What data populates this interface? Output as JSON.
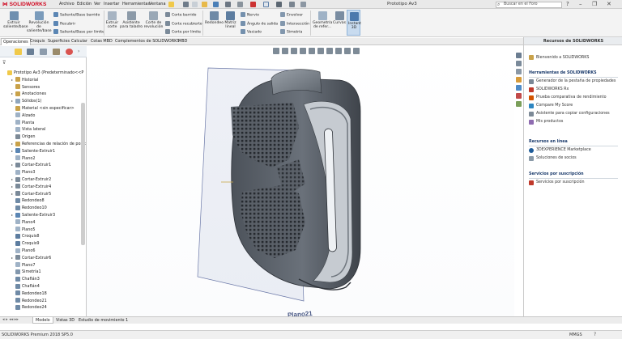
{
  "app": {
    "logo_text": "SOLIDWORKS",
    "doc_title": "Prototipo Av3"
  },
  "menu": [
    "Archivo",
    "Edición",
    "Ver",
    "Insertar",
    "Herramientas",
    "Ventana"
  ],
  "search": {
    "placeholder": "Buscar en el Foro"
  },
  "ribbon": {
    "extrude_boss": "Extruir\nsaliente/base",
    "revolve_boss": "Revolución\nde\nsaliente/base",
    "swept_boss": "Saliente/Base barrido",
    "lofted_boss": "Recubrir",
    "boundary_boss": "Saliente/Base por límite",
    "extrude_cut": "Extruir\ncorte",
    "hole_wizard": "Asistente\npara taladro",
    "revolve_cut": "Corte de\nrevolución",
    "swept_cut": "Corte barrido",
    "lofted_cut": "Corte recubierto",
    "boundary_cut": "Corte por límite",
    "fillet": "Redondeo",
    "linear_pattern": "Matriz\nlineal",
    "rib": "Nervio",
    "draft": "Ángulo de salida",
    "shell": "Vaciado",
    "wrap": "Envolver",
    "intersect": "Intersección",
    "mirror": "Simetría",
    "ref_geometry": "Geometría\nde refer...",
    "curves": "Curvas",
    "instant3d": "Instant\n3D"
  },
  "command_tabs": [
    "Operaciones",
    "Croquis",
    "Superficies",
    "Calcular",
    "Cotas MBD",
    "Complementos de SOLIDWORKS",
    "MBD"
  ],
  "feature_tree": [
    {
      "label": "Prototipo Av3  (Predeterminado<<P",
      "icon": "part",
      "level": 0
    },
    {
      "label": "Historial",
      "icon": "folder",
      "level": 1,
      "expand": true
    },
    {
      "label": "Sensores",
      "icon": "folder",
      "level": 1
    },
    {
      "label": "Anotaciones",
      "icon": "folder",
      "level": 1,
      "expand": true
    },
    {
      "label": "Sólidos(1)",
      "icon": "solid",
      "level": 1,
      "expand": true
    },
    {
      "label": "Material <sin especificar>",
      "icon": "material",
      "level": 1
    },
    {
      "label": "Alzado",
      "icon": "plane",
      "level": 1
    },
    {
      "label": "Planta",
      "icon": "plane",
      "level": 1
    },
    {
      "label": "Vista lateral",
      "icon": "plane",
      "level": 1
    },
    {
      "label": "Origen",
      "icon": "origin",
      "level": 1
    },
    {
      "label": "Referencias de relación de posic",
      "icon": "folder",
      "level": 1,
      "expand": true
    },
    {
      "label": "Saliente-Extruir1",
      "icon": "feature",
      "level": 1,
      "expand": true
    },
    {
      "label": "Plano2",
      "icon": "plane",
      "level": 1
    },
    {
      "label": "Cortar-Extruir1",
      "icon": "cut",
      "level": 1,
      "expand": true
    },
    {
      "label": "Plano3",
      "icon": "plane",
      "level": 1
    },
    {
      "label": "Cortar-Extruir2",
      "icon": "cut",
      "level": 1,
      "expand": true
    },
    {
      "label": "Cortar-Extruir4",
      "icon": "cut",
      "level": 1,
      "expand": true
    },
    {
      "label": "Cortar-Extruir5",
      "icon": "cut",
      "level": 1,
      "expand": true
    },
    {
      "label": "Redondeo8",
      "icon": "fillet",
      "level": 1
    },
    {
      "label": "Redondeo10",
      "icon": "fillet",
      "level": 1
    },
    {
      "label": "Saliente-Extruir3",
      "icon": "feature",
      "level": 1,
      "expand": true
    },
    {
      "label": "Plano4",
      "icon": "plane",
      "level": 1
    },
    {
      "label": "Plano5",
      "icon": "plane",
      "level": 1
    },
    {
      "label": "Croquis8",
      "icon": "sketch",
      "level": 1
    },
    {
      "label": "Croquis9",
      "icon": "sketch",
      "level": 1
    },
    {
      "label": "Plano6",
      "icon": "plane",
      "level": 1
    },
    {
      "label": "Cortar-Extruir6",
      "icon": "cut",
      "level": 1,
      "expand": true
    },
    {
      "label": "Plano7",
      "icon": "plane",
      "level": 1
    },
    {
      "label": "Simetría1",
      "icon": "mirror",
      "level": 1
    },
    {
      "label": "Chaflán3",
      "icon": "chamfer",
      "level": 1
    },
    {
      "label": "Chaflán4",
      "icon": "chamfer",
      "level": 1
    },
    {
      "label": "Redondeo18",
      "icon": "fillet",
      "level": 1
    },
    {
      "label": "Redondeo21",
      "icon": "fillet",
      "level": 1
    },
    {
      "label": "Redondeo24",
      "icon": "fillet",
      "level": 1
    }
  ],
  "viewport": {
    "plane_label": "Plano21"
  },
  "task_pane": {
    "title": "Recursos de SOLIDWORKS",
    "welcome": "Bienvenido a SOLIDWORKS",
    "tools_header": "Herramientas de SOLIDWORKS",
    "tools": [
      "Generador de la pestaña de propiedades",
      "SOLIDWORKS Rx",
      "Prueba comparativa de rendimiento",
      "Compare My Score",
      "Asistente para copiar configuraciones",
      "Mis productos"
    ],
    "online_header": "Recursos en línea",
    "online": [
      "3DEXPERIENCE Marketplace",
      "Soluciones de socios"
    ],
    "subscription_header": "Servicios por suscripción",
    "subscription": [
      "Servicios por suscripción"
    ]
  },
  "bottom_tabs": [
    "Modelo",
    "Vistas 3D",
    "Estudio de movimiento 1"
  ],
  "status": {
    "text": "SOLIDWORKS Premium 2018 SP5.0",
    "units": "MMGS"
  },
  "colors": {
    "accent_red": "#d0021b",
    "model_gray": "#5a6068",
    "plane_blue": "#6c79a8"
  }
}
